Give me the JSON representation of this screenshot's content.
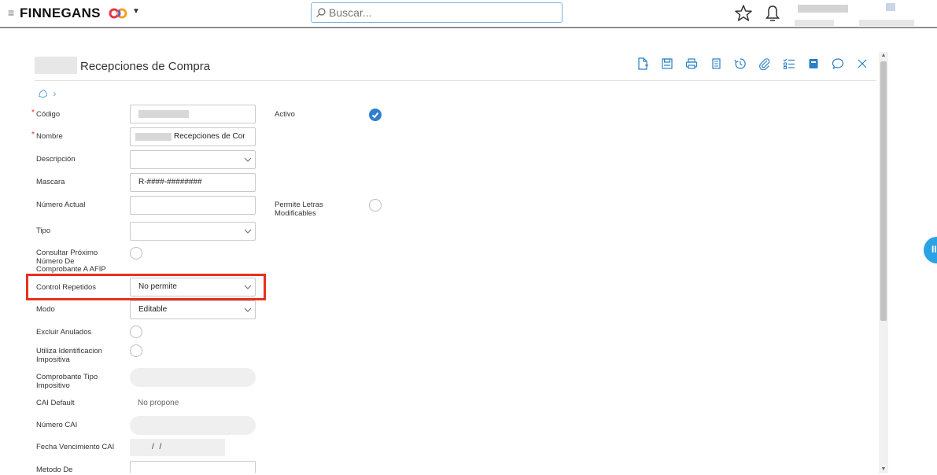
{
  "header": {
    "brand": "FINNEGANS",
    "search_placeholder": "Buscar...",
    "accent": "#2b8fd8"
  },
  "form": {
    "title": "Recepciones de Compra",
    "fields": {
      "codigo_label": "Código",
      "nombre_label": "Nombre",
      "nombre_value": "Recepciones de Cor",
      "descripcion_label": "Descripción",
      "mascara_label": "Mascara",
      "mascara_value": "R-####-########",
      "numero_actual_label": "Número Actual",
      "tipo_label": "Tipo",
      "consultar_label": "Consultar Próximo Número De Comprobante A AFIP",
      "control_repetidos_label": "Control Repetidos",
      "control_repetidos_value": "No permite",
      "modo_label": "Modo",
      "modo_value": "Editable",
      "excluir_anulados_label": "Excluir Anulados",
      "utiliza_identificacion_label": "Utiliza Identificacion Impositiva",
      "comprobante_tipo_label": "Comprobante Tipo Impositivo",
      "cai_default_label": "CAI Default",
      "cai_default_value": "No propone",
      "numero_cai_label": "Número CAI",
      "fecha_venc_label": "Fecha Vencimiento CAI",
      "fecha_venc_value": "/ /",
      "metodo_label": "Metodo De",
      "activo_label": "Activo",
      "permite_letras_label": "Permite Letras Modificables"
    },
    "required_marker": "*"
  },
  "icons": {
    "toolbar": [
      "new-doc-icon",
      "save-icon",
      "print-icon",
      "copy-icon",
      "history-icon",
      "attach-icon",
      "checklist-icon",
      "notebook-icon",
      "comment-icon",
      "close-icon"
    ]
  },
  "highlight_color": "#e4331f"
}
